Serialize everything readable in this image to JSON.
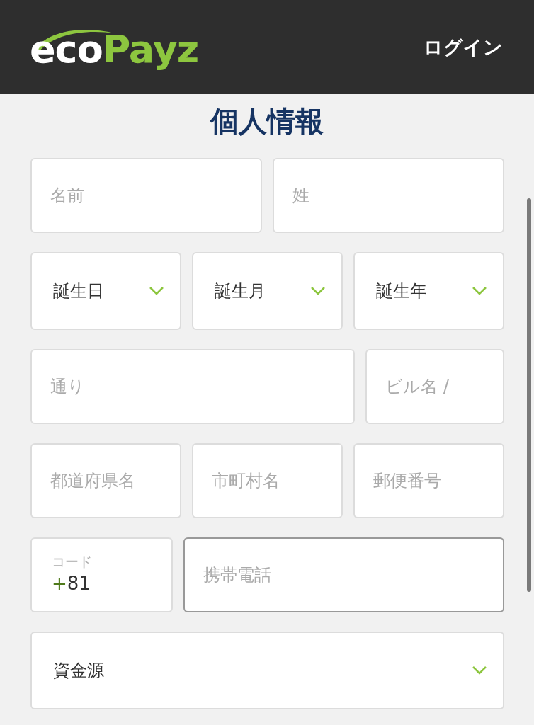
{
  "header": {
    "logo": {
      "part_1": "eco",
      "part_2": "Payz"
    },
    "login": "ログイン"
  },
  "title": "個人情報",
  "rows": [
    {
      "fields": [
        {
          "kind": "text",
          "placeholder": "名前",
          "focused": false
        },
        {
          "kind": "text",
          "placeholder": "姓",
          "focused": false
        }
      ]
    },
    {
      "fields": [
        {
          "kind": "select",
          "value": "誕生日"
        },
        {
          "kind": "select",
          "value": "誕生月"
        },
        {
          "kind": "select",
          "value": "誕生年"
        }
      ]
    },
    {
      "fields": [
        {
          "kind": "text",
          "placeholder": "通り",
          "focused": false
        },
        {
          "kind": "text",
          "placeholder": "ビル名 /",
          "focused": false
        }
      ]
    },
    {
      "fields": [
        {
          "kind": "text",
          "placeholder": "都道府県名",
          "focused": false
        },
        {
          "kind": "text",
          "placeholder": "市町村名",
          "focused": false
        },
        {
          "kind": "text",
          "placeholder": "郵便番号",
          "focused": false
        }
      ]
    },
    {
      "fields": [
        {
          "kind": "code",
          "label": "コード",
          "prefix": "+",
          "value": "81"
        },
        {
          "kind": "text",
          "placeholder": "携帯電話",
          "focused": true
        }
      ]
    },
    {
      "fields": [
        {
          "kind": "select",
          "value": "資金源"
        }
      ]
    }
  ]
}
